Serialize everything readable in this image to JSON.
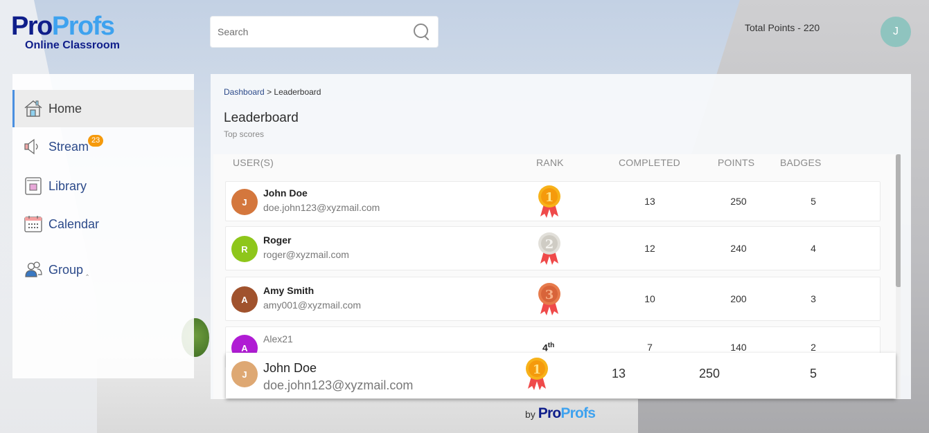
{
  "brand": {
    "logo_part1": "Pro",
    "logo_part2": "Profs",
    "subtitle": "Online Classroom",
    "colors": {
      "dark": "#0f1e8a",
      "light": "#3ea2ef"
    }
  },
  "header": {
    "search_placeholder": "Search",
    "total_points": "Total Points - 220",
    "user_initial": "J",
    "avatar_color": "#8fc4bf"
  },
  "sidebar": {
    "items": [
      {
        "label": "Home",
        "icon": "home-icon",
        "active": true
      },
      {
        "label": "Stream",
        "icon": "speaker-icon",
        "badge": "23"
      },
      {
        "label": "Library",
        "icon": "book-icon"
      },
      {
        "label": "Calendar",
        "icon": "calendar-icon"
      },
      {
        "label": "Group",
        "icon": "users-icon",
        "chevron": "chevron-up-icon"
      }
    ]
  },
  "main": {
    "breadcrumb": {
      "parent": "Dashboard",
      "separator": ">",
      "current": "Leaderboard"
    },
    "title": "Leaderboard",
    "subtitle": "Top scores",
    "columns": [
      "USER(S)",
      "RANK",
      "COMPLETED",
      "POINTS",
      "BADGES"
    ],
    "rows": [
      {
        "initial": "J",
        "avatar_color": "#d4773d",
        "name": "John Doe",
        "email": "doe.john123@xyzmail.com",
        "rank": "1",
        "medal": "gold",
        "completed": "13",
        "points": "250",
        "badges": "5"
      },
      {
        "initial": "R",
        "avatar_color": "#8ec61b",
        "name": "Roger",
        "email": "roger@xyzmail.com",
        "rank": "2",
        "medal": "silver",
        "completed": "12",
        "points": "240",
        "badges": "4"
      },
      {
        "initial": "A",
        "avatar_color": "#a0522d",
        "name": "Amy Smith",
        "email": "amy001@xyzmail.com",
        "rank": "3",
        "medal": "bronze",
        "completed": "10",
        "points": "200",
        "badges": "3"
      },
      {
        "initial": "A",
        "avatar_color": "#b01cd4",
        "name": "Alex21",
        "email": "",
        "rank": "4",
        "rank_suffix": "th",
        "completed": "7",
        "points": "140",
        "badges": "2"
      }
    ],
    "current_user": {
      "initial": "J",
      "avatar_color": "#dea873",
      "name": "John Doe",
      "email": "doe.john123@xyzmail.com",
      "rank": "1",
      "medal": "gold",
      "completed": "13",
      "points": "250",
      "badges": "5"
    }
  },
  "footer": {
    "by": "by",
    "logo_part1": "Pro",
    "logo_part2": "Profs"
  }
}
